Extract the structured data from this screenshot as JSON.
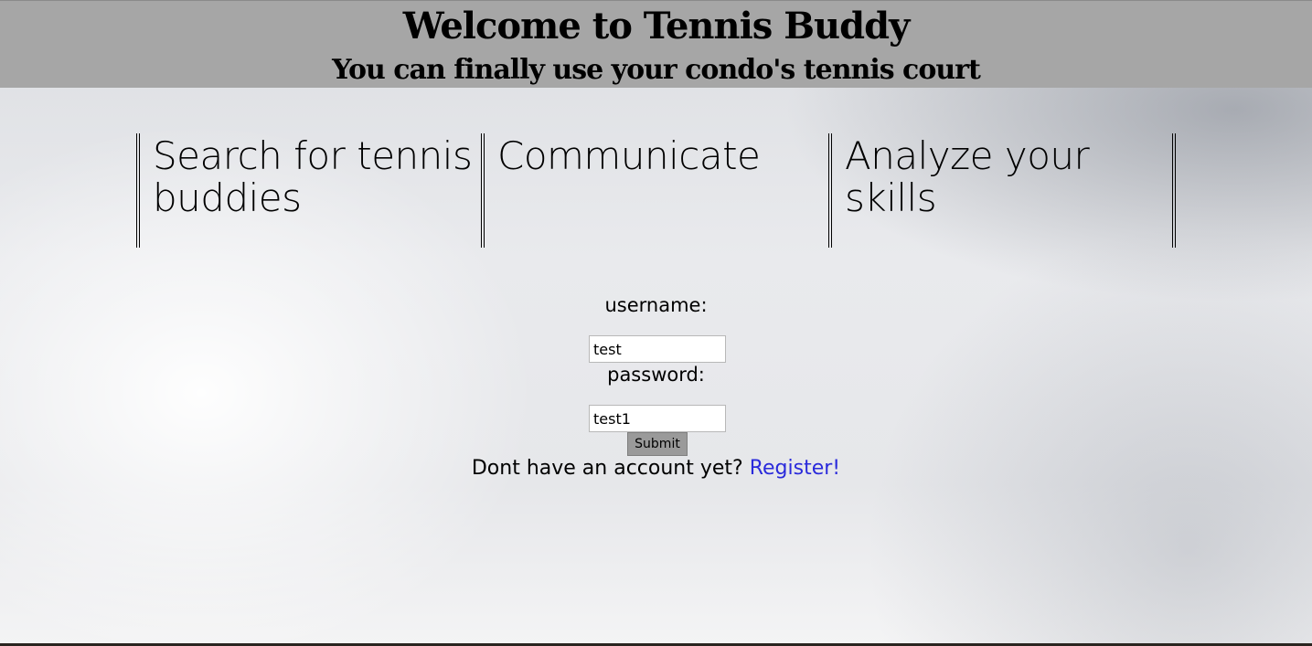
{
  "header": {
    "title": "Welcome to Tennis Buddy",
    "subtitle": "You can finally use your condo's tennis court"
  },
  "features": [
    {
      "title": "Search for tennis buddies"
    },
    {
      "title": "Communicate"
    },
    {
      "title": "Analyze your skills"
    }
  ],
  "login": {
    "username_label": "username:",
    "username_value": "test",
    "password_label": "password:",
    "password_value": "test1",
    "submit_label": "Submit",
    "register_prompt": "Dont have an account yet?",
    "register_link": "Register!"
  },
  "colors": {
    "header_bg": "#a6a6a6",
    "link": "#2a2adb",
    "submit_bg": "#9a9a9a"
  }
}
